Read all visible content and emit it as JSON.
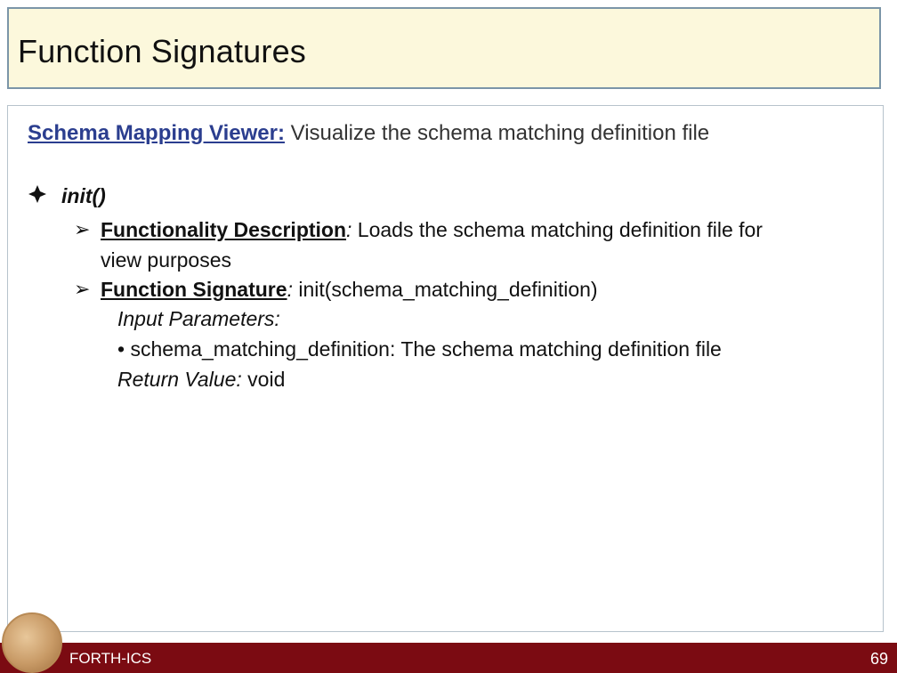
{
  "slide": {
    "title": "Function Signatures",
    "subtitle_key": "Schema Mapping Viewer:",
    "subtitle_rest": " Visualize the schema matching definition file",
    "diamond_icon": "diamond-bullet-icon",
    "init_label": "init()",
    "items": [
      {
        "arrow": "➢",
        "label": "Functionality Description",
        "colon": ":",
        "text_line1": " Loads the schema matching definition file for",
        "text_line2": "view purposes"
      },
      {
        "arrow": "➢",
        "label": "Function Signature",
        "colon": ":",
        "text_line1": " init(schema_matching_definition)"
      }
    ],
    "input_params_label": "Input Parameters:",
    "param_bullet": "•",
    "param_text": "schema_matching_definition: The schema matching definition file",
    "return_label": "Return Value:",
    "return_value": " void"
  },
  "footer": {
    "label": "FORTH-ICS",
    "page_number": "69",
    "background": "#7b0b12"
  }
}
